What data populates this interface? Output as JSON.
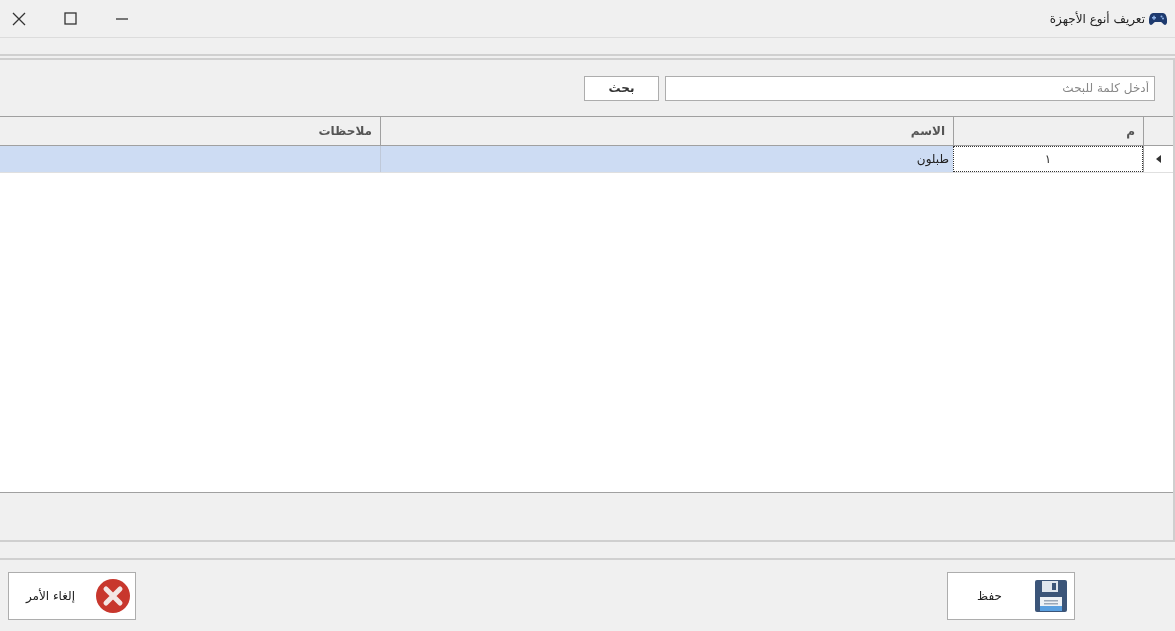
{
  "window": {
    "title": "تعريف أنوع الأجهزة"
  },
  "search": {
    "placeholder": "أدخل كلمة للبحث",
    "button": "بحث"
  },
  "table": {
    "columns": [
      "م",
      "الاسم",
      "ملاحظات"
    ],
    "rows": [
      {
        "number": "١",
        "name": "طبلون",
        "selected": true
      }
    ]
  },
  "buttons": [
    {
      "kind": "save",
      "label": "حفظ"
    },
    {
      "kind": "cancel",
      "label": "إلغاء الأمر"
    }
  ]
}
